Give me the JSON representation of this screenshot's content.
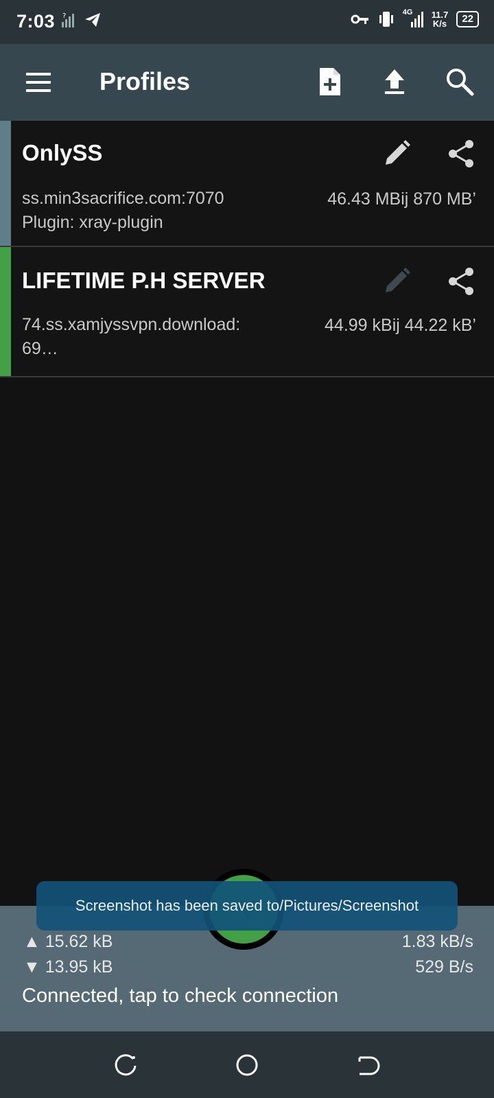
{
  "status_bar": {
    "time": "7:03",
    "netspeed_value": "11.7",
    "netspeed_unit": "K/s",
    "network_label": "4G",
    "battery": "22",
    "icons": [
      "signal-unknown-icon",
      "telegram-icon",
      "vpn-key-icon",
      "vibrate-icon",
      "signal-icon",
      "battery-icon"
    ]
  },
  "appbar": {
    "title": "Profiles",
    "icons": [
      "menu-icon",
      "add-file-icon",
      "upload-icon",
      "search-icon"
    ]
  },
  "profiles": [
    {
      "name": "OnlySS",
      "host": "ss.min3sacrifice.com:7070",
      "plugin": "Plugin: xray-plugin",
      "traffic": "46.43 MBij 870 MB’",
      "stripe_color": "#607d8b"
    },
    {
      "name": "LIFETIME P.H SERVER",
      "host_line1": "74.ss.xamjyssvpn.download:",
      "host_line2": "69…",
      "traffic": "44.99 kBij  44.22 kB’",
      "stripe_color": "#43a047"
    }
  ],
  "toast": "Screenshot has been saved to/Pictures/Screenshot",
  "bottom": {
    "tx_total": "▲ 15.62 kB",
    "rx_total": "▼ 13.95 kB",
    "tx_rate": "1.83 kB/s",
    "rx_rate": "529 B/s",
    "status": "Connected, tap to check connection"
  },
  "colors": {
    "appbar": "#37474f",
    "accent_green": "#43a047",
    "bottom_panel": "#566a75"
  }
}
